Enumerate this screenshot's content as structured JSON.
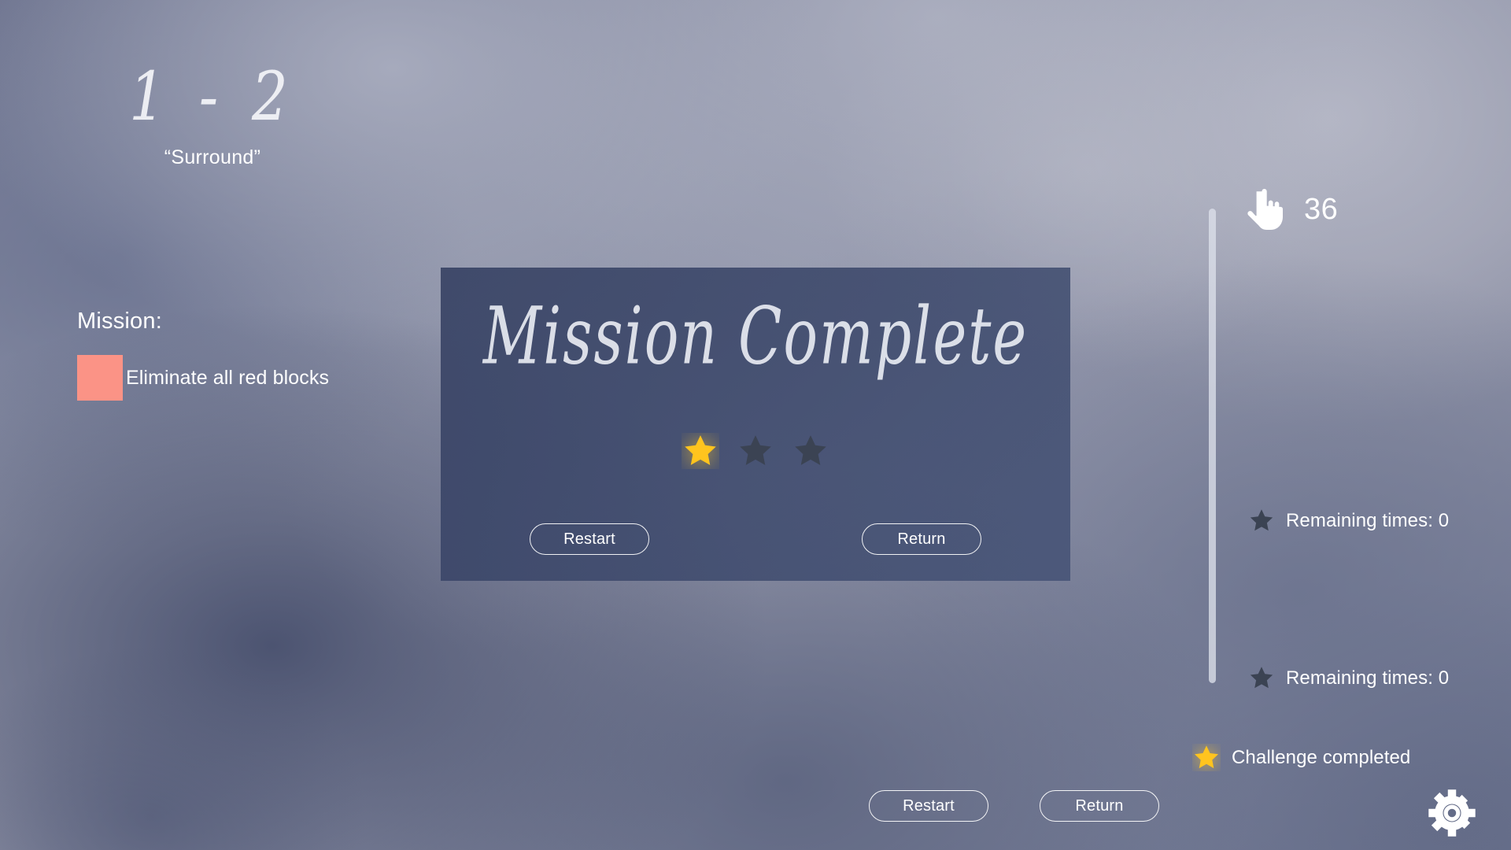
{
  "level": {
    "number": "1 - 2",
    "name": "“Surround”"
  },
  "mission": {
    "heading": "Mission:",
    "items": [
      {
        "label": "Eliminate all red blocks",
        "swatch_color": "#fb9386",
        "swatch_icon": "red-block-swatch"
      }
    ]
  },
  "dialog": {
    "title": "Mission Complete",
    "stars": [
      {
        "state": "earned",
        "icon": "star-icon"
      },
      {
        "state": "empty",
        "icon": "star-icon"
      },
      {
        "state": "empty",
        "icon": "star-icon"
      }
    ],
    "restart_label": "Restart",
    "return_label": "Return"
  },
  "hud": {
    "steps_icon": "pointing-hand-icon",
    "steps_count": "36",
    "status_rows": [
      {
        "icon": "star-icon",
        "state": "empty",
        "label": "Remaining times: 0"
      },
      {
        "icon": "star-icon",
        "state": "empty",
        "label": "Remaining times: 0"
      },
      {
        "icon": "star-icon",
        "state": "earned",
        "label": "Challenge completed"
      }
    ]
  },
  "bottom_bar": {
    "restart_label": "Restart",
    "return_label": "Return",
    "settings_icon": "gear-icon"
  },
  "colors": {
    "star_gold": "#ffc41e",
    "star_dim": "#3b4353",
    "mission_swatch": "#fb9386",
    "dialog_bg": "#3e4a71",
    "text": "#ffffff"
  }
}
